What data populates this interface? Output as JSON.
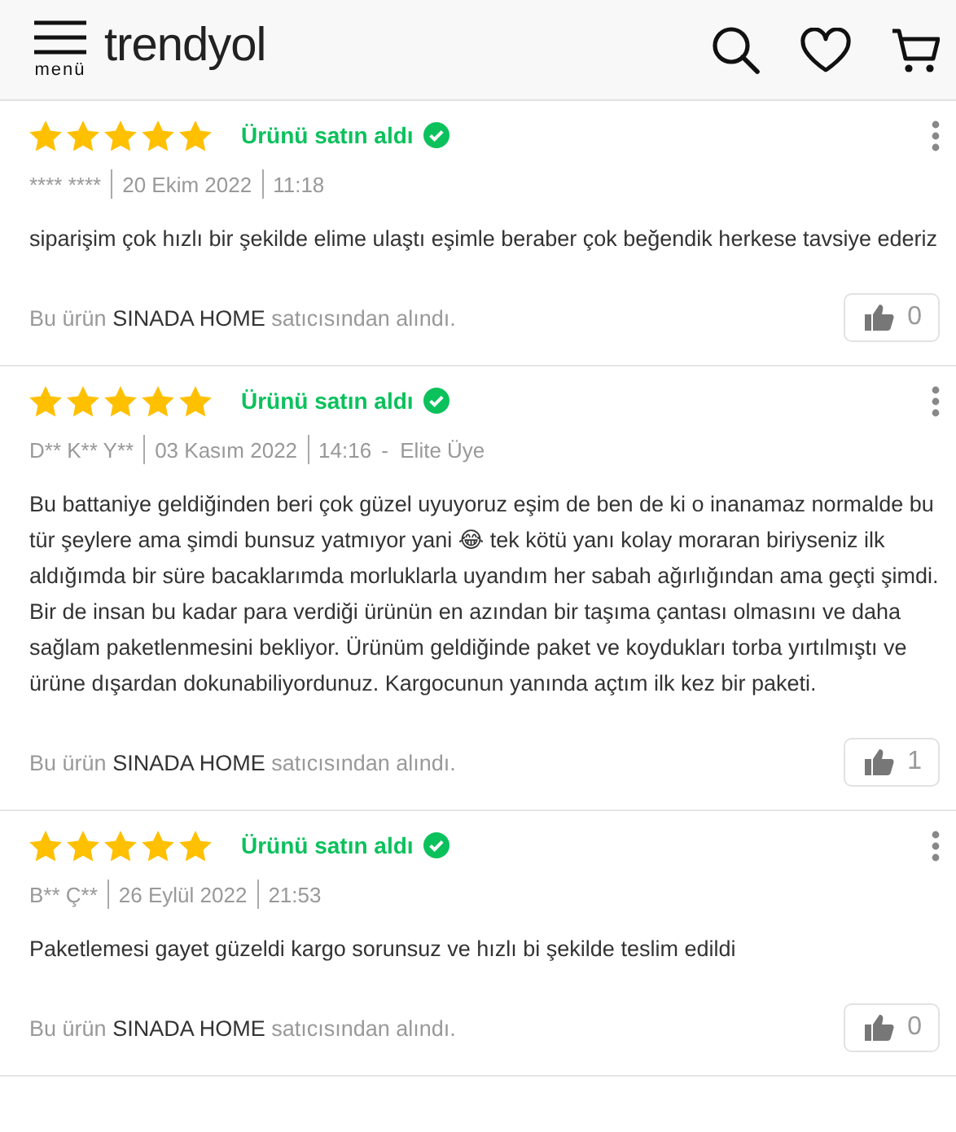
{
  "header": {
    "menu_label": "menü",
    "logo": "trendyol"
  },
  "reviews": [
    {
      "stars": 5,
      "purchase_label": "Ürünü satın aldı",
      "author": "**** ****",
      "date": "20 Ekim 2022",
      "time": "11:18",
      "text": "siparişim çok hızlı bir şekilde elime ulaştı eşimle beraber çok beğendik herkese tavsiye ederiz",
      "seller_before": "Bu ürün",
      "seller": "SINADA HOME",
      "seller_after": "satıcısından alındı.",
      "likes": "0"
    },
    {
      "stars": 5,
      "purchase_label": "Ürünü satın aldı",
      "author": "D** K** Y**",
      "date": "03 Kasım 2022",
      "time": "14:16",
      "member_status": "-  Elite Üye",
      "text": "Bu battaniye geldiğinden beri çok güzel uyuyoruz eşim de ben de ki o inanamaz normalde bu tür şeylere ama şimdi bunsuz yatmıyor yani 😂 tek kötü yanı kolay moraran biriyseniz ilk aldığımda bir süre bacaklarımda morluklarla uyandım her sabah ağırlığından ama geçti şimdi. Bir de insan bu kadar para verdiği ürünün en azından bir taşıma çantası olmasını ve daha sağlam paketlenmesini bekliyor. Ürünüm geldiğinde paket ve koydukları torba yırtılmıştı ve ürüne dışardan dokunabiliyordunuz. Kargocunun yanında açtım ilk kez bir paketi.",
      "seller_before": "Bu ürün",
      "seller": "SINADA HOME",
      "seller_after": "satıcısından alındı.",
      "likes": "1"
    },
    {
      "stars": 5,
      "purchase_label": "Ürünü satın aldı",
      "author": "B** Ç**",
      "date": "26 Eylül 2022",
      "time": "21:53",
      "text": "Paketlemesi gayet güzeldi kargo sorunsuz ve hızlı bi şekilde teslim edildi",
      "seller_before": "Bu ürün",
      "seller": "SINADA HOME",
      "seller_after": "satıcısından alındı.",
      "likes": "0"
    }
  ]
}
